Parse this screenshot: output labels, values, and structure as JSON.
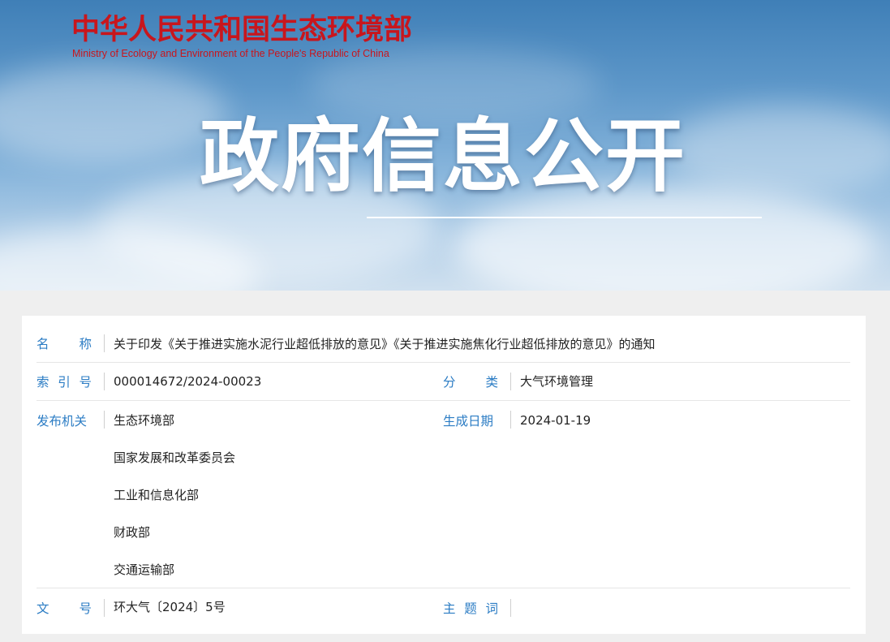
{
  "header": {
    "brand_cn": "中华人民共和国生态环境部",
    "brand_en": "Ministry of Ecology and Environment of the People's Republic of China",
    "hero_title": "政府信息公开"
  },
  "info": {
    "name_label": [
      "名",
      "称"
    ],
    "name_value": "关于印发《关于推进实施水泥行业超低排放的意见》《关于推进实施焦化行业超低排放的意见》的通知",
    "index_label": [
      "索",
      "引",
      "号"
    ],
    "index_value": "000014672/2024-00023",
    "category_label": [
      "分",
      "类"
    ],
    "category_value": "大气环境管理",
    "issuer_label": [
      "发布机关"
    ],
    "issuers": [
      "生态环境部",
      "国家发展和改革委员会",
      "工业和信息化部",
      "财政部",
      "交通运输部"
    ],
    "date_label": [
      "生成日期"
    ],
    "date_value": "2024-01-19",
    "docno_label": [
      "文",
      "号"
    ],
    "docno_value": "环大气〔2024〕5号",
    "subject_label": [
      "主",
      "题",
      "词"
    ],
    "subject_value": ""
  }
}
